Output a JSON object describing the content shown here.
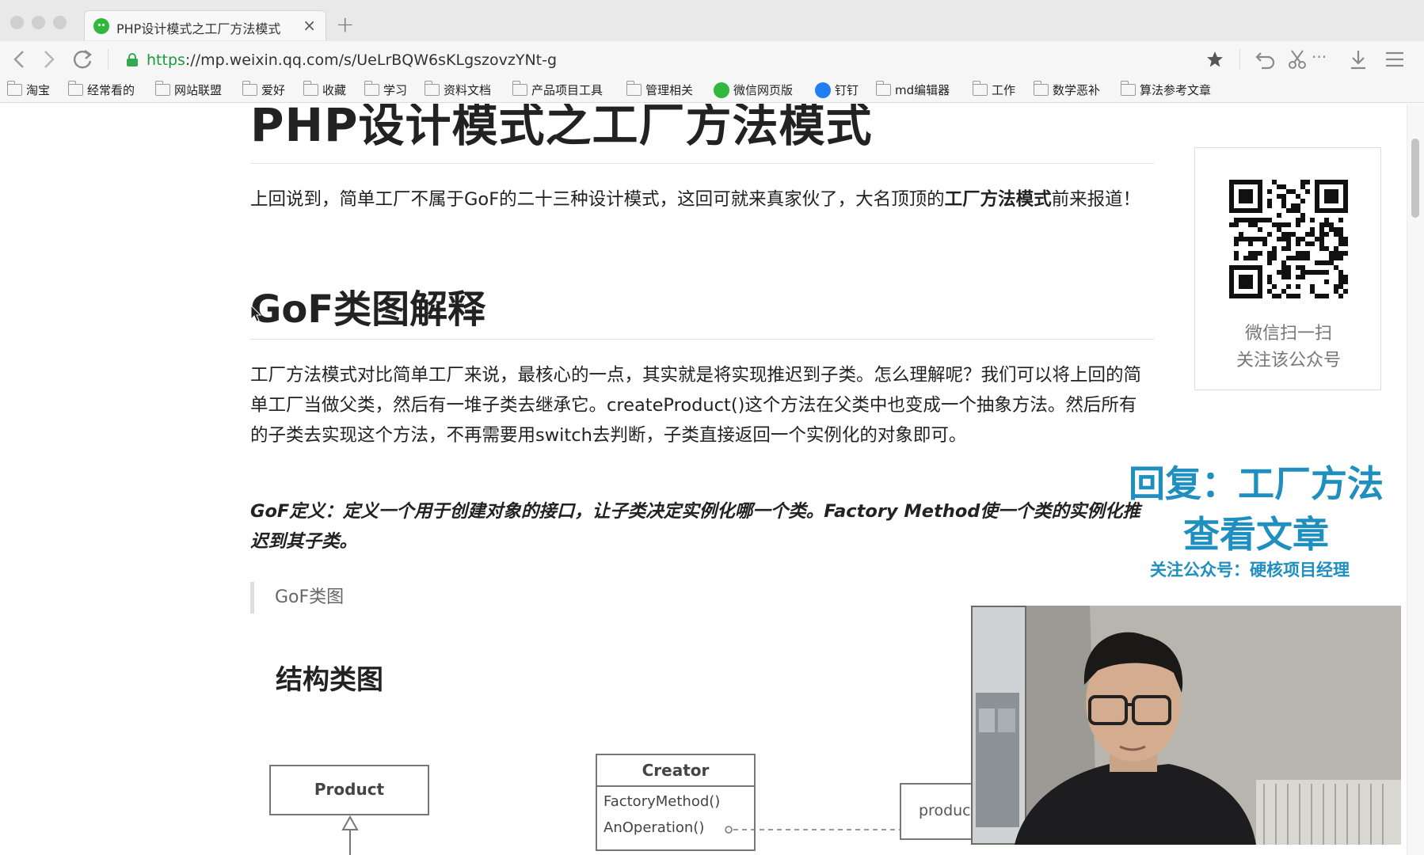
{
  "browser": {
    "tab_title": "PHP设计模式之工厂方法模式",
    "tab_close": "×",
    "new_tab": "+",
    "url_scheme": "https",
    "url_rest": "://mp.weixin.qq.com/s/UeLrBQW6sKLgszovzYNt-g",
    "icons": [
      "back-icon",
      "forward-icon",
      "reload-icon",
      "lock-icon",
      "star-icon",
      "undo-icon",
      "scissors-icon",
      "more-icon",
      "download-icon",
      "menu-icon"
    ],
    "more_label": "···"
  },
  "bookmarks": [
    {
      "label": "淘宝",
      "icon": "folder-icon"
    },
    {
      "label": "经常看的",
      "icon": "folder-icon"
    },
    {
      "label": "网站联盟",
      "icon": "folder-icon"
    },
    {
      "label": "爱好",
      "icon": "folder-icon"
    },
    {
      "label": "收藏",
      "icon": "folder-icon"
    },
    {
      "label": "学习",
      "icon": "folder-icon"
    },
    {
      "label": "资料文档",
      "icon": "folder-icon"
    },
    {
      "label": "产品项目工具",
      "icon": "folder-icon"
    },
    {
      "label": "管理相关",
      "icon": "folder-icon"
    },
    {
      "label": "微信网页版",
      "icon": "wechat-icon"
    },
    {
      "label": "钉钉",
      "icon": "dingtalk-icon"
    },
    {
      "label": "md编辑器",
      "icon": "folder-icon"
    },
    {
      "label": "工作",
      "icon": "folder-icon"
    },
    {
      "label": "数学恶补",
      "icon": "folder-icon"
    },
    {
      "label": "算法参考文章",
      "icon": "folder-icon"
    }
  ],
  "article": {
    "title": "PHP设计模式之工厂方法模式",
    "intro_text": "上回说到，简单工厂不属于GoF的二十三种设计模式，这回可就来真家伙了，大名顶顶的",
    "intro_bold": "工厂方法模式",
    "intro_tail": "前来报道！",
    "section_heading": "GoF类图解释",
    "paragraph": "工厂方法模式对比简单工厂来说，最核心的一点，其实就是将实现推迟到子类。怎么理解呢？我们可以将上回的简单工厂当做父类，然后有一堆子类去继承它。createProduct()这个方法在父类中也变成一个抽象方法。然后所有的子类去实现这个方法，不再需要用switch去判断，子类直接返回一个实例化的对象即可。",
    "gof_definition": "GoF定义：定义一个用于创建对象的接口，让子类决定实例化哪一个类。Factory Method使一个类的实例化推迟到其子类。",
    "quote": "GoF类图",
    "diagram_heading": "结构类图",
    "uml": {
      "product": "Product",
      "creator": "Creator",
      "creator_ops": [
        "FactoryMethod()",
        "AnOperation()"
      ],
      "product_note": "product"
    }
  },
  "sidebar": {
    "qr_caption_1": "微信扫一扫",
    "qr_caption_2": "关注该公众号"
  },
  "promo": {
    "reply_line_1": "回复：工厂方法",
    "reply_line_2": "查看文章",
    "follow_line": "关注公众号：硬核项目经理",
    "color": "#1e8fbf"
  },
  "colors": {
    "secure_green": "#1a9b3c",
    "wechat_green": "#2fb83c",
    "dingtalk_blue": "#1f7ef0"
  }
}
